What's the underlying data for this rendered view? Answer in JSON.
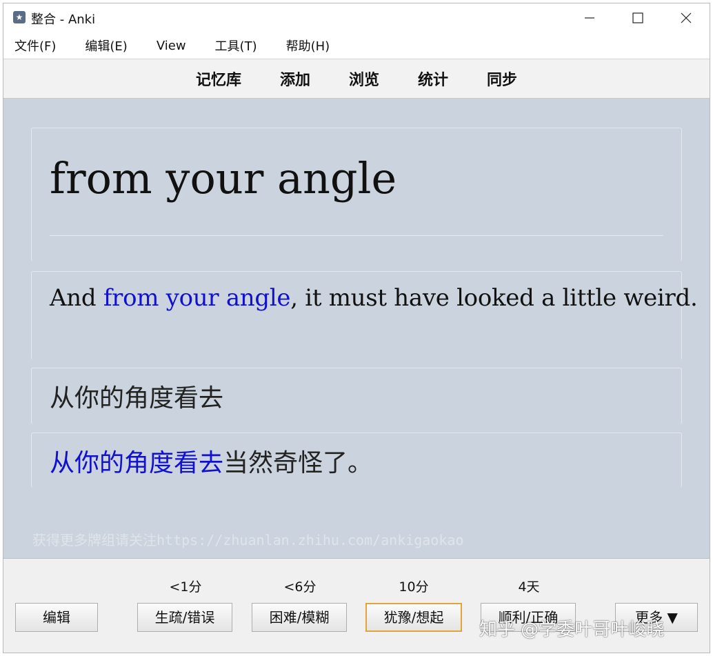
{
  "window": {
    "title": "整合 - Anki",
    "controls": {
      "minimize": "minimize-icon",
      "maximize": "maximize-icon",
      "close": "close-icon"
    }
  },
  "menu": [
    "文件(F)",
    "编辑(E)",
    "View",
    "工具(T)",
    "帮助(H)"
  ],
  "toolbar": [
    "记忆库",
    "添加",
    "浏览",
    "统计",
    "同步"
  ],
  "card": {
    "headword": "from your angle",
    "sentence_before": "And ",
    "sentence_highlight": "from your angle",
    "sentence_after": ", it must have looked a little weird.",
    "translation": "从你的角度看去",
    "cn_sentence_highlight": "从你的角度看去",
    "cn_sentence_after": "当然奇怪了。",
    "watermark": "获得更多牌组请关注https://zhuanlan.zhihu.com/ankigaokao",
    "highlight_color": "#1010d0",
    "background_color": "#cbd4de"
  },
  "bottom": {
    "edit_label": "编辑",
    "answers": [
      {
        "interval": "<1分",
        "label": "生疏/错误"
      },
      {
        "interval": "<6分",
        "label": "困难/模糊"
      },
      {
        "interval": "10分",
        "label": "犹豫/想起"
      },
      {
        "interval": "4天",
        "label": "顺利/正确"
      }
    ],
    "more_label": "更多 ▼",
    "default_button_color": "#e0a43a"
  },
  "overlay": {
    "zhihu_watermark": "知乎 @学委叶哥叶峻晓"
  }
}
